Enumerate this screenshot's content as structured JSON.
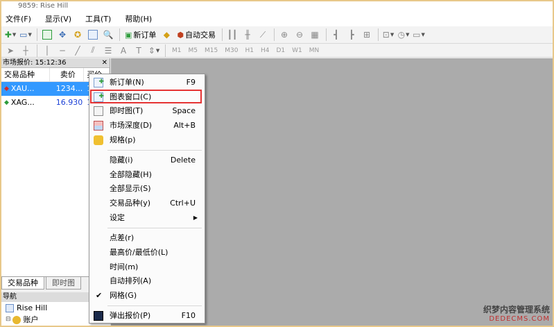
{
  "window": {
    "title": "9859: Rise Hill"
  },
  "menubar": {
    "items": [
      "文件(F)",
      "显示(V)",
      "工具(T)",
      "帮助(H)"
    ]
  },
  "toolbar1": {
    "new_order": "新订单",
    "auto_trade": "自动交易"
  },
  "toolbar2": {
    "timeframes": [
      "M1",
      "M5",
      "M15",
      "M30",
      "H1",
      "H4",
      "D1",
      "W1",
      "MN"
    ]
  },
  "market_watch": {
    "title": "市场报价: 15:12:36",
    "columns": [
      "交易品种",
      "卖价",
      "买价"
    ],
    "rows": [
      {
        "symbol": "XAU...",
        "bid": "1234...",
        "ask": "1"
      },
      {
        "symbol": "XAG...",
        "bid": "16.930",
        "ask": "1"
      }
    ],
    "tabs": [
      "交易品种",
      "即时图"
    ]
  },
  "navigator": {
    "title": "导航",
    "items": [
      "Rise Hill",
      "账户"
    ]
  },
  "context_menu": {
    "items": [
      {
        "label": "新订单(N)",
        "key": "F9"
      },
      {
        "label": "图表窗口(C)",
        "key": ""
      },
      {
        "label": "即时图(T)",
        "key": "Space"
      },
      {
        "label": "市场深度(D)",
        "key": "Alt+B"
      },
      {
        "label": "规格(p)",
        "key": ""
      },
      {
        "label": "隐藏(i)",
        "key": "Delete"
      },
      {
        "label": "全部隐藏(H)",
        "key": ""
      },
      {
        "label": "全部显示(S)",
        "key": ""
      },
      {
        "label": "交易品种(y)",
        "key": "Ctrl+U"
      },
      {
        "label": "设定",
        "key": ""
      },
      {
        "label": "点差(r)",
        "key": ""
      },
      {
        "label": "最高价/最低价(L)",
        "key": ""
      },
      {
        "label": "时间(m)",
        "key": ""
      },
      {
        "label": "自动排列(A)",
        "key": ""
      },
      {
        "label": "网格(G)",
        "key": ""
      },
      {
        "label": "弹出报价(P)",
        "key": "F10"
      }
    ]
  },
  "watermark": {
    "line1": "织梦内容管理系统",
    "line2": "DEDECMS.COM"
  }
}
